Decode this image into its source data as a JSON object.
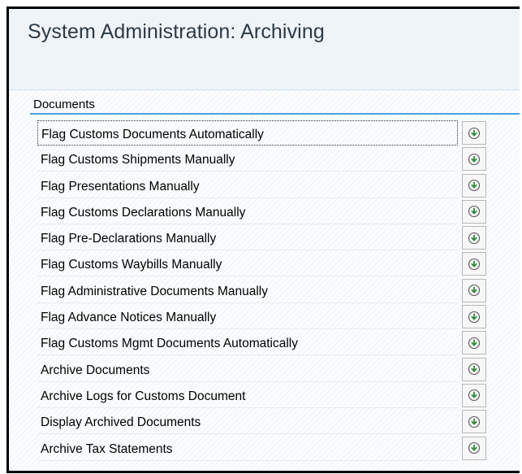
{
  "window": {
    "title": "System Administration: Archiving"
  },
  "section": {
    "label": "Documents"
  },
  "rows": [
    {
      "label": "Flag Customs Documents Automatically",
      "icon": "execute-icon"
    },
    {
      "label": "Flag Customs Shipments Manually",
      "icon": "execute-icon"
    },
    {
      "label": "Flag Presentations Manually",
      "icon": "execute-icon"
    },
    {
      "label": "Flag Customs Declarations Manually",
      "icon": "execute-icon"
    },
    {
      "label": "Flag Pre-Declarations Manually",
      "icon": "execute-icon"
    },
    {
      "label": "Flag Customs Waybills Manually",
      "icon": "execute-icon"
    },
    {
      "label": "Flag Administrative Documents Manually",
      "icon": "execute-icon"
    },
    {
      "label": "Flag Advance Notices Manually",
      "icon": "execute-icon"
    },
    {
      "label": "Flag Customs Mgmt Documents Automatically",
      "icon": "execute-icon"
    },
    {
      "label": "Archive Documents",
      "icon": "execute-icon"
    },
    {
      "label": "Archive Logs for Customs Document",
      "icon": "execute-icon"
    },
    {
      "label": "Display Archived Documents",
      "icon": "execute-icon"
    },
    {
      "label": "Archive Tax Statements",
      "icon": "execute-icon"
    }
  ],
  "colors": {
    "header_bg": "#eff4f9",
    "title_text": "#2c3a46",
    "section_line": "#4aa3df",
    "icon_green": "#2e8b3e"
  }
}
